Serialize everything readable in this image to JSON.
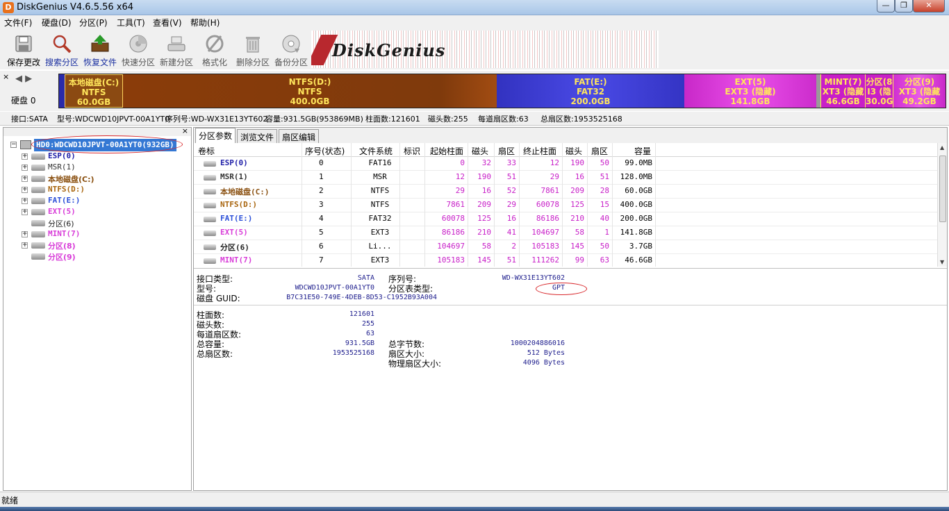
{
  "window": {
    "title": "DiskGenius V4.6.5.56 x64",
    "minimize": "—",
    "maximize": "❐",
    "close": "✕"
  },
  "menu": [
    "文件(F)",
    "硬盘(D)",
    "分区(P)",
    "工具(T)",
    "查看(V)",
    "帮助(H)"
  ],
  "toolbar": [
    {
      "label": "保存更改",
      "icon": "save-icon"
    },
    {
      "label": "搜索分区",
      "icon": "search-icon"
    },
    {
      "label": "恢复文件",
      "icon": "recover-icon"
    },
    {
      "label": "快速分区",
      "icon": "quick-partition-icon"
    },
    {
      "label": "新建分区",
      "icon": "new-partition-icon"
    },
    {
      "label": "格式化",
      "icon": "format-icon"
    },
    {
      "label": "删除分区",
      "icon": "trash-icon"
    },
    {
      "label": "备份分区",
      "icon": "backup-icon"
    }
  ],
  "banner": {
    "logo": "DiskGenius"
  },
  "diskbar": {
    "close": "×",
    "arrows": "◀ ▶",
    "disk_label": "硬盘 0",
    "partitions": [
      {
        "name": "本地磁盘(C:)",
        "fs": "NTFS",
        "size": "60.0GB",
        "color": "#8b4a12"
      },
      {
        "name": "NTFS(D:)",
        "fs": "NTFS",
        "size": "400.0GB",
        "color": "#8a3c0a"
      },
      {
        "name": "FAT(E:)",
        "fs": "FAT32",
        "size": "200.0GB",
        "color": "#3a3ad6"
      },
      {
        "name": "EXT(5)",
        "fs": "EXT3 (隐藏)",
        "size": "141.8GB",
        "color": "#d828d8"
      },
      {
        "name": "MINT(7)",
        "fs": "XT3 (隐藏",
        "size": "46.6GB",
        "color": "#c81ec8"
      },
      {
        "name": "分区(8",
        "fs": "I3 (隐",
        "size": "30.0GI",
        "color": "#c81ec8"
      },
      {
        "name": "分区(9)",
        "fs": "XT3 (隐藏",
        "size": "49.2GB",
        "color": "#d828d8"
      }
    ]
  },
  "infoline": {
    "interface": "接口:SATA",
    "model": "型号:WDCWD10JPVT-00A1YT0",
    "serial": "序列号:WD-WX31E13YT602",
    "capacity": "容量:931.5GB(953869MB)",
    "cylinders": "柱面数:121601",
    "heads": "磁头数:255",
    "sectors_per_track": "每道扇区数:63",
    "total_sectors": "总扇区数:1953525168"
  },
  "tree": {
    "close": "×",
    "root": "HD0:WDCWD10JPVT-00A1YT0(932GB)",
    "items": [
      {
        "label": "ESP(0)",
        "color": "#1e1ea8"
      },
      {
        "label": "MSR(1)",
        "color": "#333333"
      },
      {
        "label": "本地磁盘(C:)",
        "color": "#8a5010"
      },
      {
        "label": "NTFS(D:)",
        "color": "#a8640c"
      },
      {
        "label": "FAT(E:)",
        "color": "#2b4fd8"
      },
      {
        "label": "EXT(5)",
        "color": "#d83cd8"
      },
      {
        "label": "分区(6)",
        "color": "#222222"
      },
      {
        "label": "MINT(7)",
        "color": "#d83cd8"
      },
      {
        "label": "分区(8)",
        "color": "#d83cd8"
      },
      {
        "label": "分区(9)",
        "color": "#d83cd8"
      }
    ]
  },
  "tabs": [
    "分区参数",
    "浏览文件",
    "扇区编辑"
  ],
  "table": {
    "headers": [
      "卷标",
      "序号(状态)",
      "文件系统",
      "标识",
      "起始柱面",
      "磁头",
      "扇区",
      "终止柱面",
      "磁头",
      "扇区",
      "容量"
    ],
    "rows": [
      {
        "label": "ESP(0)",
        "color": "#1e1ea8",
        "cells": [
          "0",
          "FAT16",
          "",
          "0",
          "32",
          "33",
          "12",
          "190",
          "50",
          "99.0MB"
        ]
      },
      {
        "label": "MSR(1)",
        "color": "#333333",
        "cells": [
          "1",
          "MSR",
          "",
          "12",
          "190",
          "51",
          "29",
          "16",
          "51",
          "128.0MB"
        ]
      },
      {
        "label": "本地磁盘(C:)",
        "color": "#8a5010",
        "cells": [
          "2",
          "NTFS",
          "",
          "29",
          "16",
          "52",
          "7861",
          "209",
          "28",
          "60.0GB"
        ]
      },
      {
        "label": "NTFS(D:)",
        "color": "#a8640c",
        "cells": [
          "3",
          "NTFS",
          "",
          "7861",
          "209",
          "29",
          "60078",
          "125",
          "15",
          "400.0GB"
        ]
      },
      {
        "label": "FAT(E:)",
        "color": "#2b4fd8",
        "cells": [
          "4",
          "FAT32",
          "",
          "60078",
          "125",
          "16",
          "86186",
          "210",
          "40",
          "200.0GB"
        ]
      },
      {
        "label": "EXT(5)",
        "color": "#d83cd8",
        "cells": [
          "5",
          "EXT3",
          "",
          "86186",
          "210",
          "41",
          "104697",
          "58",
          "1",
          "141.8GB"
        ]
      },
      {
        "label": "分区(6)",
        "color": "#222222",
        "cells": [
          "6",
          "Li...",
          "",
          "104697",
          "58",
          "2",
          "105183",
          "145",
          "50",
          "3.7GB"
        ]
      },
      {
        "label": "MINT(7)",
        "color": "#d83cd8",
        "cells": [
          "7",
          "EXT3",
          "",
          "105183",
          "145",
          "51",
          "111262",
          "99",
          "63",
          "46.6GB"
        ]
      }
    ]
  },
  "details": {
    "interface_type_label": "接口类型:",
    "interface_type_value": "SATA",
    "serial_label": "序列号:",
    "serial_value": "WD-WX31E13YT602",
    "model_label": "型号:",
    "model_value": "WDCWD10JPVT-00A1YT0",
    "partition_table_label": "分区表类型:",
    "partition_table_value": "GPT",
    "guid_label": "磁盘 GUID:",
    "guid_value": "B7C31E50-749E-4DEB-8D53-C1952B93A004",
    "cylinders_label": "柱面数:",
    "cylinders_value": "121601",
    "heads_label": "磁头数:",
    "heads_value": "255",
    "spt_label": "每道扇区数:",
    "spt_value": "63",
    "capacity_label": "总容量:",
    "capacity_value": "931.5GB",
    "total_bytes_label": "总字节数:",
    "total_bytes_value": "1000204886016",
    "total_sectors_label": "总扇区数:",
    "total_sectors_value": "1953525168",
    "sector_size_label": "扇区大小:",
    "sector_size_value": "512 Bytes",
    "phys_sector_label": "物理扇区大小:",
    "phys_sector_value": "4096 Bytes"
  },
  "status": "就绪"
}
